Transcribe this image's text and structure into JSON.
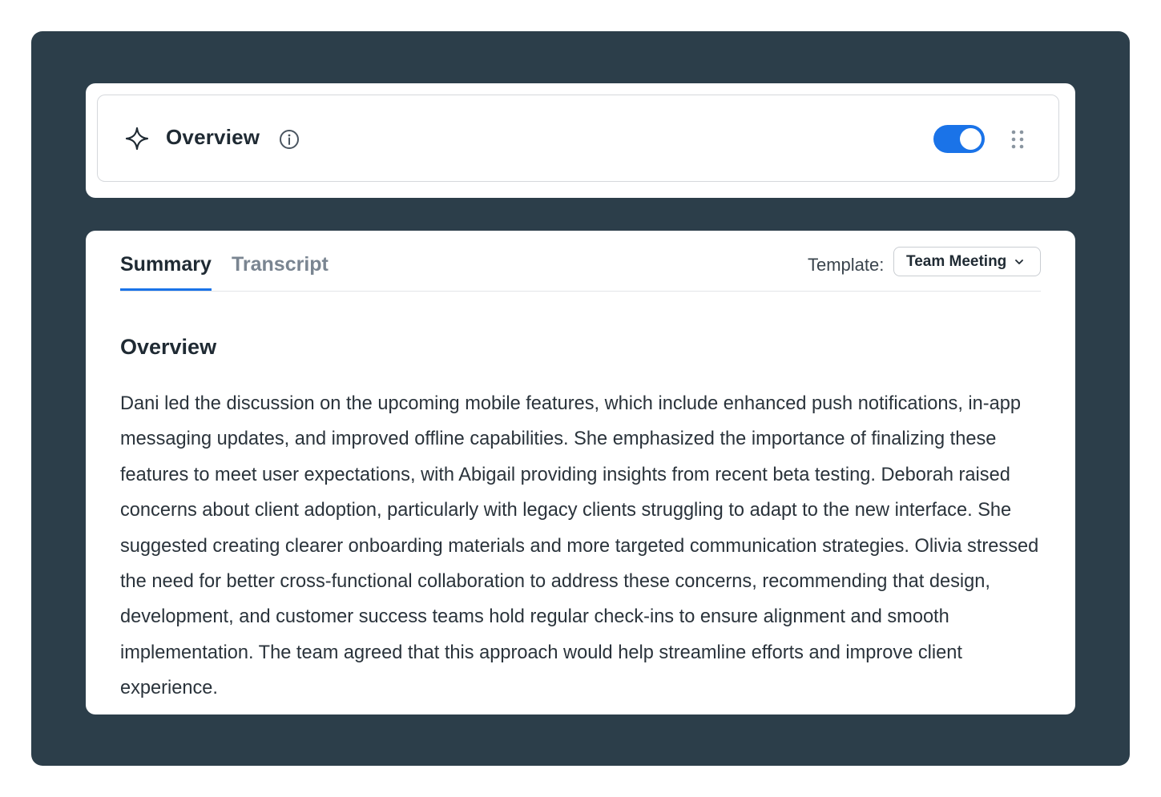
{
  "header": {
    "title": "Overview",
    "toggle_on": true,
    "icons": {
      "sparkle": "sparkle-icon",
      "info": "info-icon",
      "drag": "drag-handle-icon"
    }
  },
  "tabs": [
    {
      "label": "Summary",
      "active": true
    },
    {
      "label": "Transcript",
      "active": false
    }
  ],
  "template": {
    "label": "Template:",
    "selected": "Team Meeting"
  },
  "section": {
    "heading": "Overview",
    "body": "Dani led the discussion on the upcoming mobile features, which include enhanced push notifications, in-app messaging updates, and improved offline capabilities. She emphasized the importance of finalizing these features to meet user expectations, with Abigail providing insights from recent beta testing. Deborah raised concerns about client adoption, particularly with legacy clients struggling to adapt to the new interface. She suggested creating clearer onboarding materials and more targeted communication strategies. Olivia stressed the need for better cross-functional collaboration to address these concerns, recommending that design, development, and customer success teams hold regular check-ins to ensure alignment and smooth implementation. The team agreed that this approach would help streamline efforts and improve client experience."
  },
  "colors": {
    "frame": "#2c3e4a",
    "accent": "#1a73e8",
    "text": "#1f2a33",
    "muted": "#7a8591"
  }
}
